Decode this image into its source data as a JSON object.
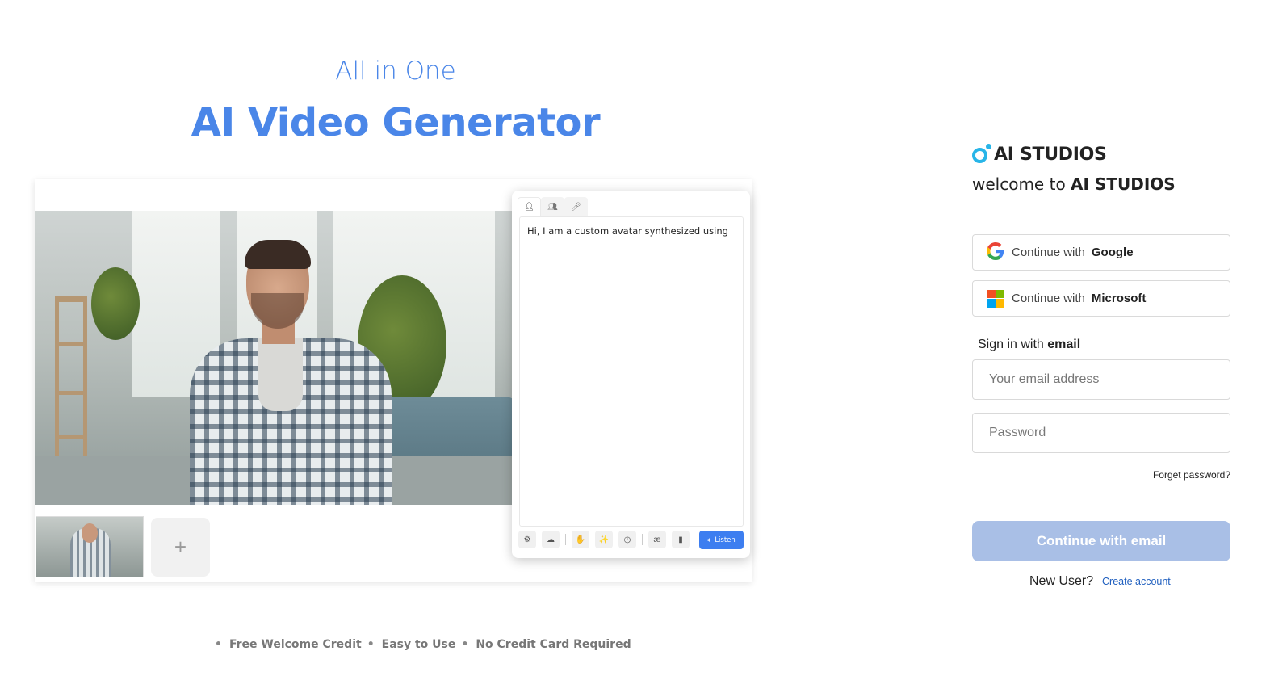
{
  "hero": {
    "subtitle": "All in One",
    "title": "AI Video Generator"
  },
  "editor": {
    "panel_tabs": [
      "avatar-tab",
      "people-tab",
      "mic-tab"
    ],
    "script_text": "Hi, I am a custom avatar synthesized using",
    "tools": [
      "settings-icon",
      "cloud-icon",
      "gesture-icon",
      "magic-icon",
      "clock-icon",
      "ae-icon",
      "pause-icon"
    ],
    "listen_label": "Listen",
    "add_label": "+"
  },
  "features": [
    "Free Welcome Credit",
    "Easy to Use",
    "No Credit Card Required"
  ],
  "login": {
    "logo_text": "AI STUDIOS",
    "welcome_prefix": "welcome to",
    "welcome_brand": "AI STUDIOS",
    "google": {
      "prefix": "Continue with",
      "brand": "Google"
    },
    "microsoft": {
      "prefix": "Continue with",
      "brand": "Microsoft"
    },
    "signin_prefix": "Sign in with",
    "signin_emphasis": "email",
    "email_placeholder": "Your email address",
    "password_placeholder": "Password",
    "forget_password": "Forget password?",
    "continue_email": "Continue with email",
    "new_user": "New User?",
    "create_account": "Create account"
  },
  "colors": {
    "accent": "#4a86e8",
    "logo": "#28b5e8",
    "continue_disabled": "#a9bfe6",
    "link": "#1f5fbf"
  }
}
